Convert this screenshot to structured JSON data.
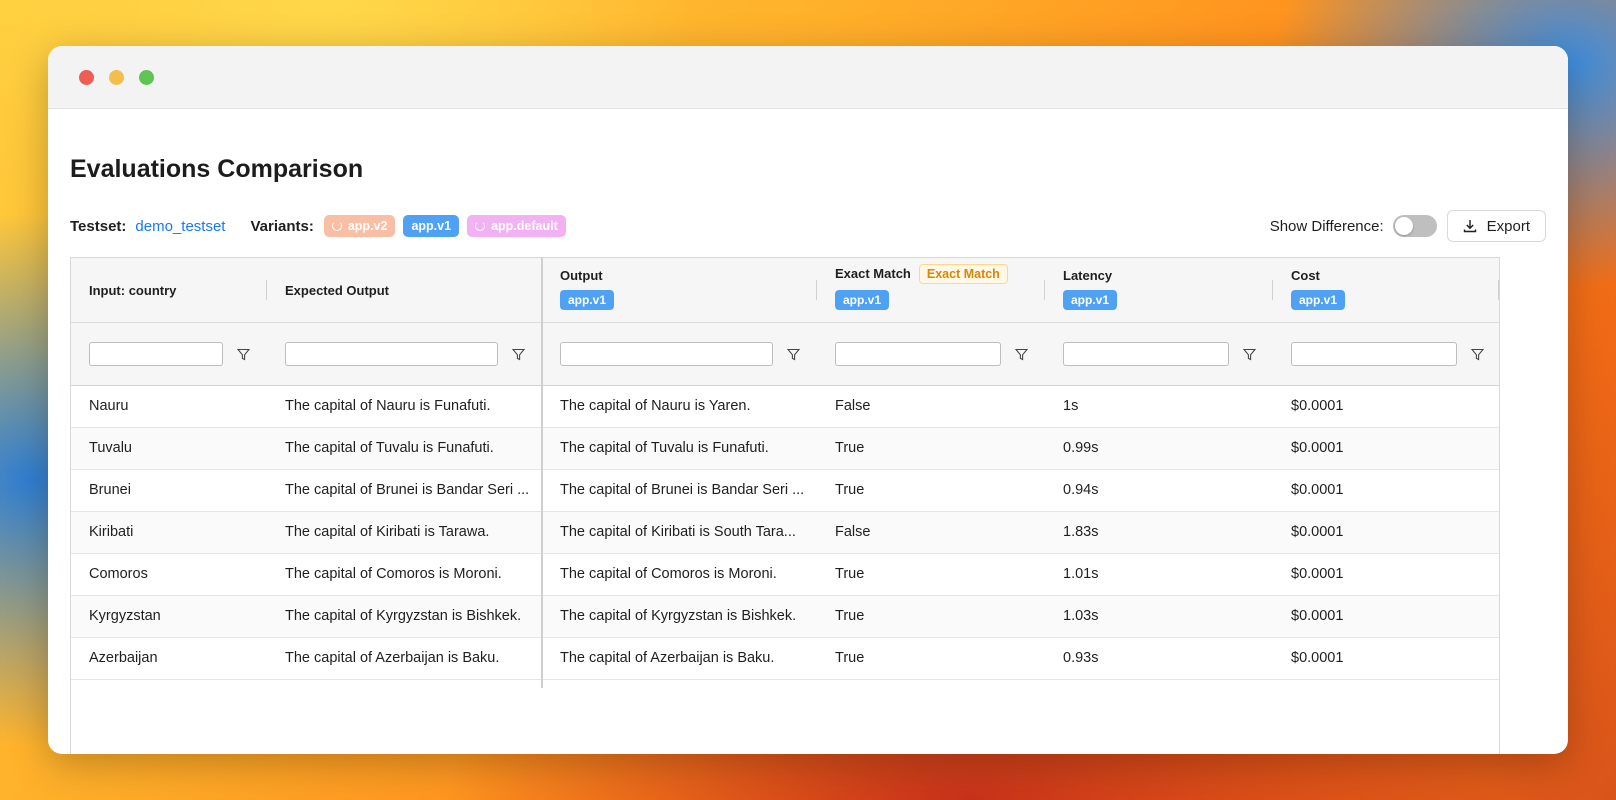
{
  "page": {
    "title": "Evaluations Comparison",
    "testset_label": "Testset:",
    "testset_value": "demo_testset",
    "variants_label": "Variants:",
    "variants": [
      {
        "label": "app.v2",
        "color": "#f9bfa4",
        "loading": true
      },
      {
        "label": "app.v1",
        "color": "#4ea1f3",
        "loading": false
      },
      {
        "label": "app.default",
        "color": "#f2b1f3",
        "loading": true
      }
    ],
    "show_difference_label": "Show Difference:",
    "show_difference_enabled": false,
    "export_label": "Export"
  },
  "table": {
    "columns": [
      {
        "title": "Input: country",
        "tag": ""
      },
      {
        "title": "Expected Output",
        "tag": ""
      },
      {
        "title": "Output",
        "tag": "app.v1"
      },
      {
        "title": "Exact Match",
        "badge": "Exact Match",
        "tag": "app.v1"
      },
      {
        "title": "Latency",
        "tag": "app.v1"
      },
      {
        "title": "Cost",
        "tag": "app.v1"
      }
    ],
    "rows": [
      [
        "Nauru",
        "The capital of Nauru is Funafuti.",
        "The capital of Nauru is Yaren.",
        "False",
        "1s",
        "$0.0001"
      ],
      [
        "Tuvalu",
        "The capital of Tuvalu is Funafuti.",
        "The capital of Tuvalu is Funafuti.",
        "True",
        "0.99s",
        "$0.0001"
      ],
      [
        "Brunei",
        "The capital of Brunei is Bandar Seri ...",
        "The capital of Brunei is Bandar Seri ...",
        "True",
        "0.94s",
        "$0.0001"
      ],
      [
        "Kiribati",
        "The capital of Kiribati is Tarawa.",
        "The capital of Kiribati is South Tara...",
        "False",
        "1.83s",
        "$0.0001"
      ],
      [
        "Comoros",
        "The capital of Comoros is Moroni.",
        "The capital of Comoros is Moroni.",
        "True",
        "1.01s",
        "$0.0001"
      ],
      [
        "Kyrgyzstan",
        "The capital of Kyrgyzstan is Bishkek.",
        "The capital of Kyrgyzstan is Bishkek.",
        "True",
        "1.03s",
        "$0.0001"
      ],
      [
        "Azerbaijan",
        "The capital of Azerbaijan is Baku.",
        "The capital of Azerbaijan is Baku.",
        "True",
        "0.93s",
        "$0.0001"
      ]
    ]
  },
  "icons": {
    "filter": "filter-icon",
    "export": "download-icon"
  },
  "colors": {
    "link": "#1677ff",
    "tag_blue": "#4ea1f3",
    "badge_warning": "#d48806"
  }
}
